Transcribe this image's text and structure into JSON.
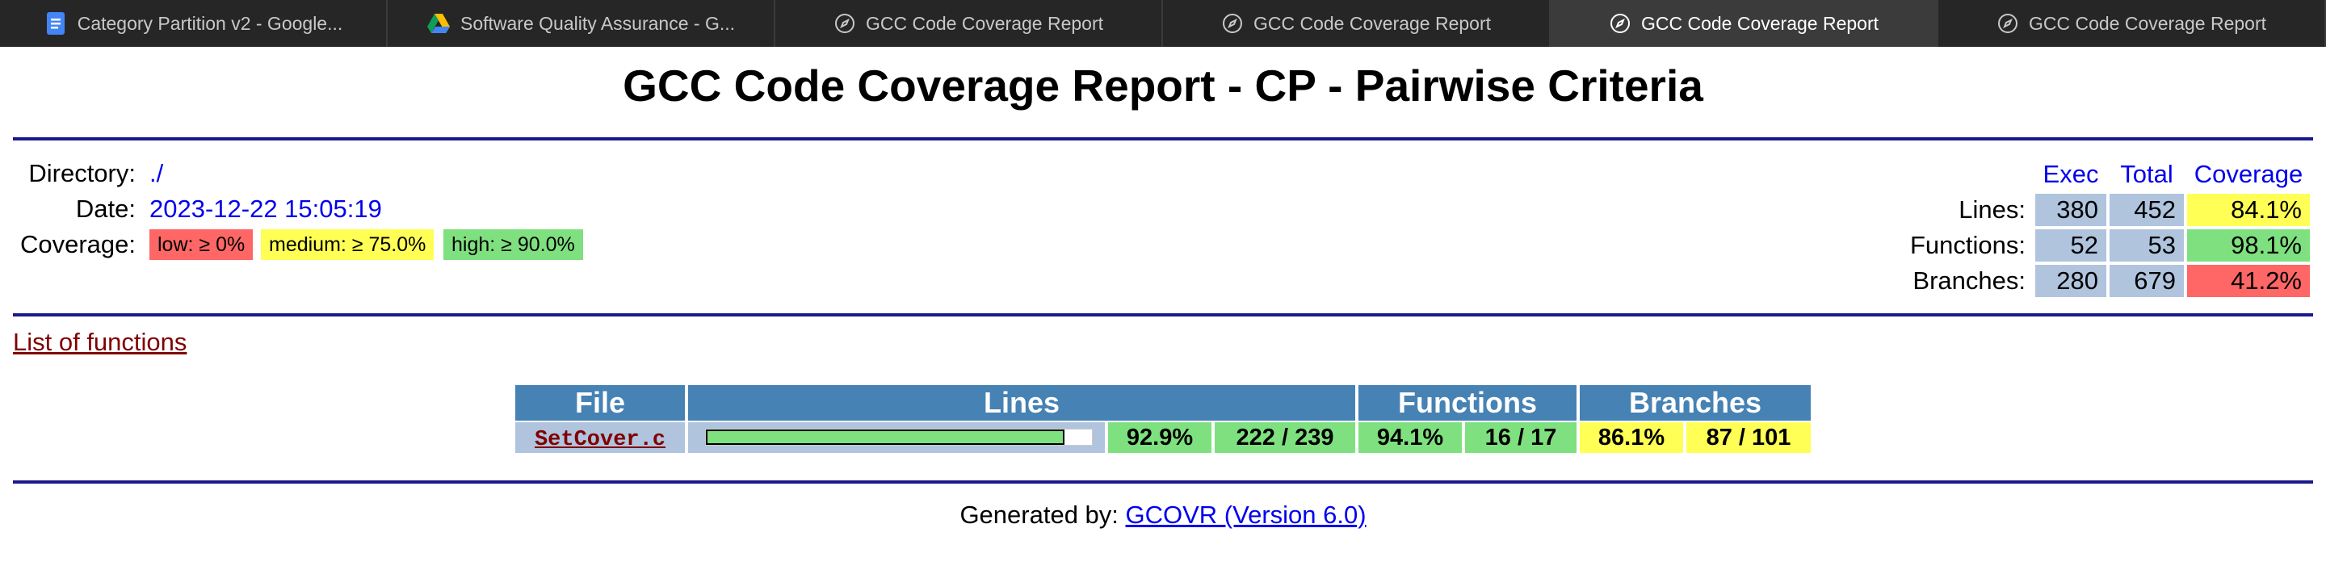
{
  "browser": {
    "tabs": [
      {
        "title": "Category Partition v2 - Google...",
        "icon": "google-docs-icon",
        "active": false
      },
      {
        "title": "Software Quality Assurance - G...",
        "icon": "google-drive-icon",
        "active": false
      },
      {
        "title": "GCC Code Coverage Report",
        "icon": "compass-icon",
        "active": false
      },
      {
        "title": "GCC Code Coverage Report",
        "icon": "compass-icon",
        "active": false
      },
      {
        "title": "GCC Code Coverage Report",
        "icon": "compass-icon",
        "active": true
      },
      {
        "title": "GCC Code Coverage Report",
        "icon": "compass-icon",
        "active": false
      }
    ]
  },
  "report": {
    "title": "GCC Code Coverage Report - CP - Pairwise Criteria",
    "info": {
      "directory_label": "Directory:",
      "directory_value": "./",
      "date_label": "Date:",
      "date_value": "2023-12-22 15:05:19",
      "coverage_label": "Coverage:",
      "legend": {
        "low": "low: ≥ 0%",
        "medium": "medium: ≥ 75.0%",
        "high": "high: ≥ 90.0%"
      }
    },
    "summary": {
      "headers": {
        "exec": "Exec",
        "total": "Total",
        "coverage": "Coverage"
      },
      "rows": [
        {
          "label": "Lines:",
          "exec": "380",
          "total": "452",
          "coverage": "84.1%",
          "level": "medium"
        },
        {
          "label": "Functions:",
          "exec": "52",
          "total": "53",
          "coverage": "98.1%",
          "level": "high"
        },
        {
          "label": "Branches:",
          "exec": "280",
          "total": "679",
          "coverage": "41.2%",
          "level": "low"
        }
      ]
    },
    "functions_link": "List of functions",
    "file_table": {
      "headers": {
        "file": "File",
        "lines": "Lines",
        "functions": "Functions",
        "branches": "Branches"
      },
      "rows": [
        {
          "file": "SetCover.c",
          "lines_fraction": 0.929,
          "lines_pct": "92.9%",
          "lines_count": "222 / 239",
          "functions_pct": "94.1%",
          "functions_count": "16 / 17",
          "branches_pct": "86.1%",
          "branches_count": "87 / 101"
        }
      ]
    },
    "footer": {
      "prefix": "Generated by: ",
      "link": "GCOVR (Version 6.0)"
    }
  },
  "colors": {
    "low": "#ff6666",
    "medium": "#ffff55",
    "high": "#7fe07f",
    "count_cell": "#b0c4de",
    "header": "#4682b4",
    "rule": "#1a1a8c",
    "link": "#0000ee",
    "visited_link": "#800000"
  }
}
